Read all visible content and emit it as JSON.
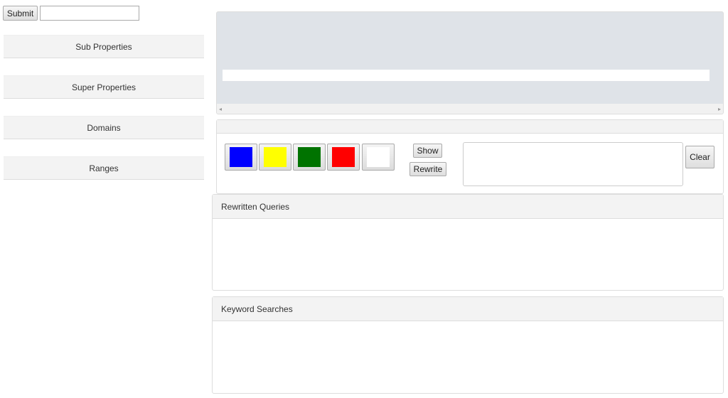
{
  "toolbar": {
    "submit_label": "Submit",
    "input_value": ""
  },
  "sidebar": {
    "items": [
      {
        "label": "Sub Properties"
      },
      {
        "label": "Super Properties"
      },
      {
        "label": "Domains"
      },
      {
        "label": "Ranges"
      }
    ]
  },
  "colors": {
    "swatches": [
      "#0000ff",
      "#ffff00",
      "#007300",
      "#ff0000",
      "#ffffff"
    ],
    "top_panel_bg": "#dfe3e8"
  },
  "controls": {
    "show_label": "Show",
    "rewrite_label": "Rewrite",
    "clear_label": "Clear",
    "query_value": ""
  },
  "panels": {
    "rewritten_title": "Rewritten Queries",
    "keyword_title": "Keyword Searches"
  },
  "scrollbar": {
    "left_arrow": "◂",
    "right_arrow": "▸"
  }
}
